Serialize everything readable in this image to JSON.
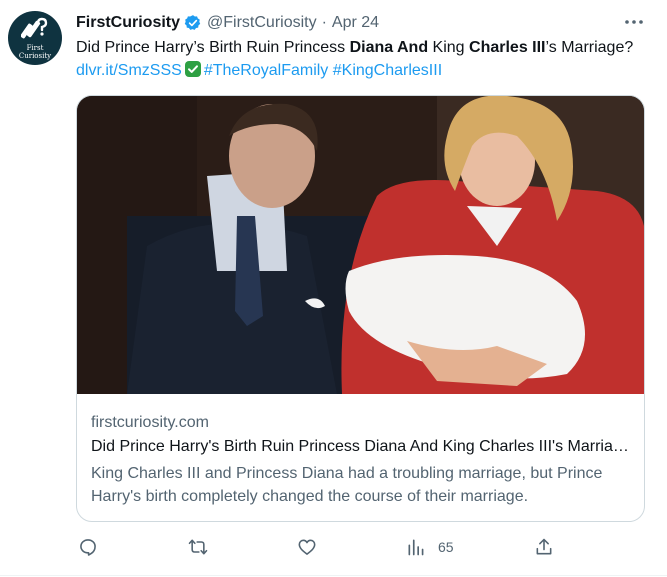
{
  "user": {
    "display_name": "FirstCuriosity",
    "handle": "@FirstCuriosity",
    "separator": "·",
    "date": "Apr 24",
    "avatar_line1": "First",
    "avatar_line2": "Curiosity",
    "verified_color": "#1d9bf0",
    "avatar_color": "#0f3340"
  },
  "tweet": {
    "t1": "Did Prince Harry’s Birth Ruin Princess ",
    "b1": "Diana And",
    "t2": " King ",
    "b2": "Charles III",
    "t3": "’s Marriage? ",
    "link": "dlvr.it/SmzSSS",
    "hashtag1": "#TheRoyalFamily",
    "hashtag2": "#KingCharlesIII",
    "link_color": "#1d9bf0"
  },
  "card": {
    "domain": "firstcuriosity.com",
    "title": "Did Prince Harry's Birth Ruin Princess Diana And King Charles III's Marriage?",
    "description": "King Charles III and Princess Diana had a troubling marriage, but Prince Harry's birth completely changed the course of their marriage."
  },
  "actions": {
    "reply_icon": "reply-icon",
    "retweet_icon": "retweet-icon",
    "like_icon": "like-icon",
    "views_icon": "views-icon",
    "views_count": "65",
    "share_icon": "share-icon"
  }
}
